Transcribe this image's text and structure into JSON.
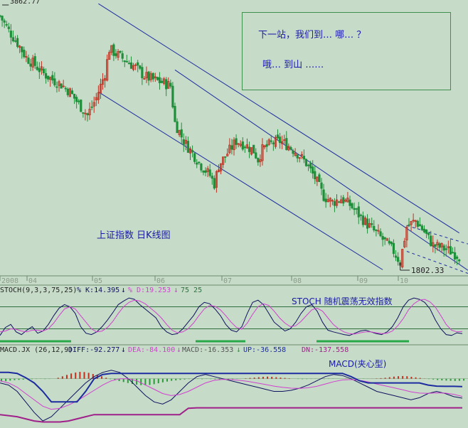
{
  "notes": {
    "line1": "下一站，我们到… 哪… ？",
    "line2": "哦… 到山 ……"
  },
  "price_panel": {
    "title": "上证指数  日K线图",
    "high_label": "3862.77",
    "low_label": "1802.33",
    "x_ticks": [
      "2008",
      "04",
      "05",
      "06",
      "07",
      "08",
      "09",
      "10"
    ]
  },
  "stoch_panel": {
    "params": "STOCH(9,3,3,75,25)",
    "k_label": "% K:14.395",
    "d_label": "% D:19.253",
    "levels_label": "75  25",
    "annotation": "STOCH 随机震荡无效指数",
    "colors": {
      "k": "#101060",
      "d": "#d040d0",
      "level": "#2f6f3f",
      "bar": "#29a84a"
    }
  },
  "macd_panel": {
    "params": "MACD.JX (26,12,9)",
    "diff_label": "DIFF:-92.277",
    "dea_label": "DEA:-84.100",
    "macd_label": "MACD:-16.353",
    "up_label": "UP:-36.558",
    "dn_label": "DN:-137.558",
    "annotation": "MACD(夹心型)",
    "colors": {
      "pos": "#c03020",
      "neg": "#2a9a3a",
      "diff": "#101060",
      "dea": "#d040d0",
      "up": "#1c2ca0",
      "dn": "#a0208a"
    }
  },
  "chart_data": [
    {
      "type": "candlestick",
      "title": "上证指数  日K线图",
      "x_ticks": [
        "2008",
        "04",
        "05",
        "06",
        "07",
        "08",
        "09",
        "10"
      ],
      "annotations": [
        "3862.77",
        "1802.33"
      ],
      "ylim": [
        1700,
        3950
      ],
      "close_path": [
        [
          0,
          3820
        ],
        [
          4,
          3700
        ],
        [
          8,
          3600
        ],
        [
          12,
          3480
        ],
        [
          16,
          3420
        ],
        [
          20,
          3350
        ],
        [
          24,
          3300
        ],
        [
          28,
          3260
        ],
        [
          32,
          3200
        ],
        [
          36,
          3100
        ],
        [
          40,
          3010
        ],
        [
          44,
          3150
        ],
        [
          48,
          3350
        ],
        [
          50,
          3550
        ],
        [
          54,
          3500
        ],
        [
          58,
          3450
        ],
        [
          62,
          3400
        ],
        [
          66,
          3330
        ],
        [
          70,
          3300
        ],
        [
          74,
          3280
        ],
        [
          78,
          3250
        ],
        [
          80,
          2950
        ],
        [
          84,
          2800
        ],
        [
          88,
          2700
        ],
        [
          92,
          2600
        ],
        [
          96,
          2520
        ],
        [
          98,
          2450
        ],
        [
          100,
          2600
        ],
        [
          104,
          2700
        ],
        [
          108,
          2800
        ],
        [
          112,
          2770
        ],
        [
          116,
          2720
        ],
        [
          118,
          2650
        ],
        [
          120,
          2730
        ],
        [
          124,
          2780
        ],
        [
          128,
          2800
        ],
        [
          132,
          2760
        ],
        [
          136,
          2700
        ],
        [
          140,
          2620
        ],
        [
          144,
          2500
        ],
        [
          148,
          2350
        ],
        [
          152,
          2300
        ],
        [
          156,
          2330
        ],
        [
          160,
          2280
        ],
        [
          164,
          2200
        ],
        [
          168,
          2120
        ],
        [
          172,
          2050
        ],
        [
          176,
          1980
        ],
        [
          180,
          1900
        ],
        [
          183,
          1810
        ],
        [
          186,
          2100
        ],
        [
          190,
          2150
        ],
        [
          194,
          2060
        ],
        [
          198,
          1950
        ],
        [
          202,
          1930
        ],
        [
          206,
          1900
        ],
        [
          210,
          1860
        ]
      ],
      "channel": {
        "upper_start": [
          45,
          3920
        ],
        "upper_end": [
          210,
          2050
        ],
        "lower_start": [
          45,
          3200
        ],
        "lower_end": [
          175,
          1750
        ]
      },
      "colors": {
        "up": "#c03020",
        "down": "#1f8f3a",
        "channel": "#1c2ca0"
      }
    },
    {
      "type": "line",
      "title": "STOCH(9,3,3,75,25)",
      "series": [
        {
          "name": "% K",
          "values": [
            10,
            28,
            35,
            18,
            12,
            22,
            30,
            15,
            20,
            35,
            55,
            72,
            80,
            75,
            60,
            30,
            15,
            12,
            18,
            30,
            45,
            62,
            80,
            88,
            95,
            92,
            80,
            70,
            60,
            50,
            30,
            18,
            12,
            14,
            25,
            40,
            55,
            75,
            85,
            82,
            70,
            55,
            35,
            22,
            18,
            30,
            60,
            85,
            90,
            80,
            60,
            40,
            30,
            20,
            25,
            40,
            60,
            75,
            80,
            65,
            40,
            22,
            18,
            15,
            12,
            10,
            15,
            20,
            22,
            18,
            14,
            12,
            18,
            30,
            50,
            75,
            90,
            95,
            92,
            85,
            70,
            45,
            25,
            12,
            10,
            16,
            14
          ]
        },
        {
          "name": "% D",
          "values": [
            18,
            20,
            25,
            24,
            20,
            18,
            22,
            22,
            20,
            25,
            38,
            55,
            70,
            75,
            70,
            55,
            40,
            25,
            18,
            20,
            28,
            42,
            60,
            75,
            85,
            90,
            88,
            82,
            72,
            62,
            50,
            35,
            22,
            16,
            18,
            25,
            38,
            55,
            70,
            78,
            76,
            68,
            55,
            40,
            28,
            24,
            38,
            58,
            75,
            82,
            78,
            65,
            50,
            38,
            30,
            32,
            42,
            55,
            68,
            72,
            65,
            50,
            35,
            25,
            18,
            14,
            13,
            16,
            18,
            18,
            16,
            14,
            15,
            20,
            32,
            48,
            68,
            82,
            90,
            92,
            86,
            74,
            55,
            35,
            22,
            18,
            19
          ]
        }
      ],
      "levels": [
        75,
        25
      ],
      "ylim": [
        0,
        100
      ]
    },
    {
      "type": "bar",
      "title": "MACD.JX (26,12,9)",
      "values": [
        -30,
        -26,
        -20,
        -15,
        -12,
        -10,
        -8,
        -5,
        -3,
        -2,
        -4,
        -3,
        0,
        10,
        25,
        40,
        55,
        65,
        72,
        70,
        62,
        50,
        38,
        25,
        10,
        -5,
        -15,
        -25,
        -35,
        -45,
        -55,
        -62,
        -68,
        -70,
        -66,
        -58,
        -48,
        -38,
        -30,
        -22,
        -18,
        -12,
        -8,
        -4,
        0,
        -3,
        -5,
        -2,
        -4,
        -6,
        -8,
        -10,
        -8,
        -5,
        -3,
        0,
        4,
        8,
        12,
        16,
        20,
        22,
        20,
        16,
        12,
        8,
        4,
        0,
        -3,
        -5,
        -4,
        -3,
        -2,
        -3,
        -4,
        -3,
        -2,
        -1,
        0,
        2,
        -1,
        -2,
        -1,
        -2,
        -1,
        1,
        3,
        6,
        10,
        16,
        22,
        26,
        28,
        26,
        20,
        14,
        8,
        2,
        -4,
        -8,
        -14,
        -18,
        -20,
        -22,
        -24,
        -22,
        -20
      ],
      "lines": [
        {
          "name": "DIFF",
          "values": [
            -20,
            -30,
            -60,
            -110,
            -160,
            -200,
            -180,
            -140,
            -100,
            -60,
            -20,
            10,
            30,
            40,
            30,
            0,
            -40,
            -80,
            -110,
            -120,
            -100,
            -60,
            -20,
            10,
            20,
            10,
            0,
            -10,
            -20,
            -30,
            -40,
            -50,
            -60,
            -60,
            -55,
            -45,
            -30,
            -10,
            10,
            20,
            15,
            0,
            -20,
            -40,
            -60,
            -70,
            -80,
            -90,
            -100,
            -90,
            -70,
            -60,
            -70,
            -85,
            -92
          ]
        },
        {
          "name": "DEA",
          "values": [
            -10,
            -20,
            -40,
            -70,
            -100,
            -130,
            -145,
            -140,
            -125,
            -105,
            -80,
            -55,
            -30,
            -10,
            0,
            0,
            -10,
            -30,
            -50,
            -70,
            -80,
            -75,
            -60,
            -40,
            -20,
            -8,
            -3,
            -4,
            -8,
            -13,
            -20,
            -27,
            -35,
            -41,
            -45,
            -46,
            -43,
            -36,
            -25,
            -14,
            -6,
            -4,
            -8,
            -15,
            -25,
            -34,
            -43,
            -52,
            -62,
            -68,
            -69,
            -67,
            -68,
            -74,
            -84
          ]
        },
        {
          "name": "UP",
          "values": [
            30,
            30,
            25,
            5,
            -20,
            -60,
            -110,
            -110,
            -110,
            -110,
            -60,
            0,
            20,
            25,
            25,
            25,
            25,
            25,
            25,
            25,
            25,
            25,
            25,
            25,
            25,
            25,
            25,
            25,
            25,
            25,
            25,
            25,
            25,
            25,
            25,
            25,
            25,
            25,
            25,
            25,
            25,
            10,
            -10,
            -20,
            -20,
            -20,
            -20,
            -20,
            -20,
            -20,
            -30,
            -35,
            -36,
            -36,
            -37
          ]
        },
        {
          "name": "DN",
          "values": [
            -170,
            -175,
            -180,
            -190,
            -200,
            -205,
            -205,
            -205,
            -200,
            -190,
            -180,
            -170,
            -170,
            -170,
            -170,
            -170,
            -170,
            -170,
            -170,
            -170,
            -170,
            -170,
            -140,
            -138,
            -138,
            -138,
            -138,
            -138,
            -138,
            -138,
            -138,
            -138,
            -138,
            -138,
            -138,
            -138,
            -138,
            -138,
            -138,
            -138,
            -138,
            -138,
            -138,
            -138,
            -138,
            -138,
            -138,
            -138,
            -138,
            -138,
            -138,
            -138,
            -138,
            -138,
            -138
          ]
        }
      ],
      "ylim": [
        -220,
        110
      ]
    }
  ]
}
